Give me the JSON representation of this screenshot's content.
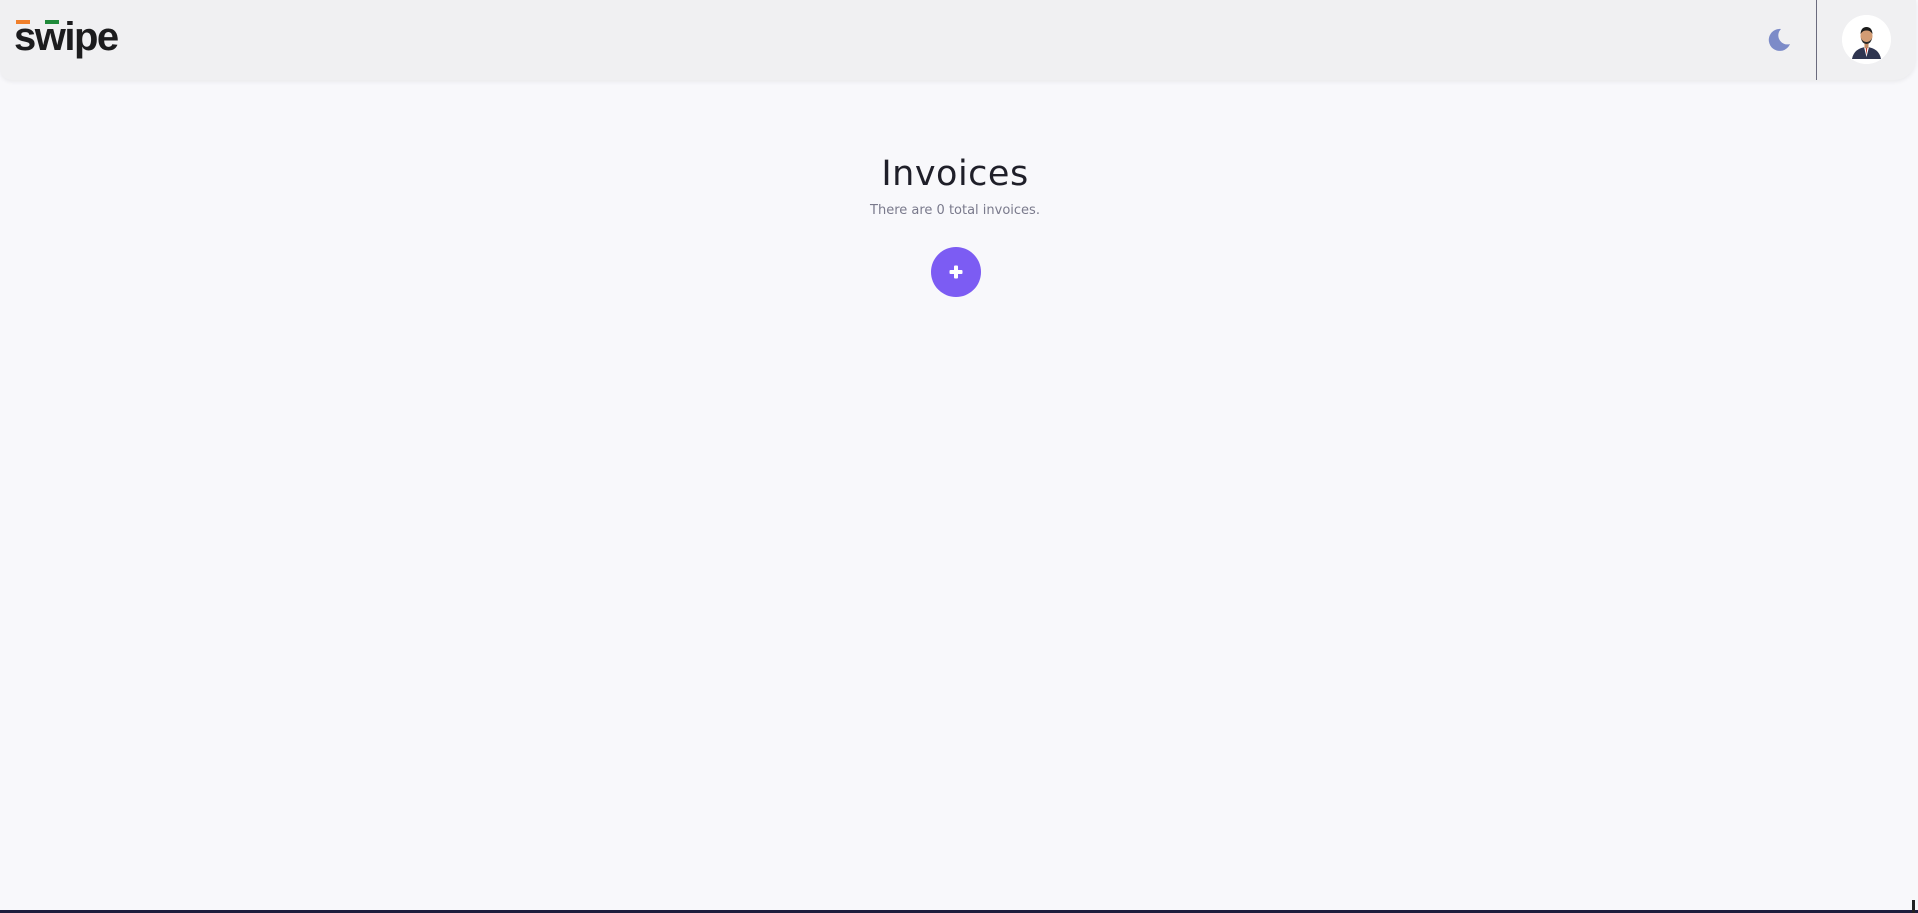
{
  "header": {
    "logo_text": "swipe",
    "theme_toggle_icon": "moon-icon",
    "avatar_icon": "user-avatar-icon",
    "colors": {
      "logo_orange": "#f07f2a",
      "logo_green": "#1f8a3a",
      "moon": "#7c8bc8"
    }
  },
  "main": {
    "title": "Invoices",
    "subtitle": "There are 0 total invoices.",
    "add_button_icon": "plus-icon",
    "accent_color": "#7c5cf3"
  }
}
